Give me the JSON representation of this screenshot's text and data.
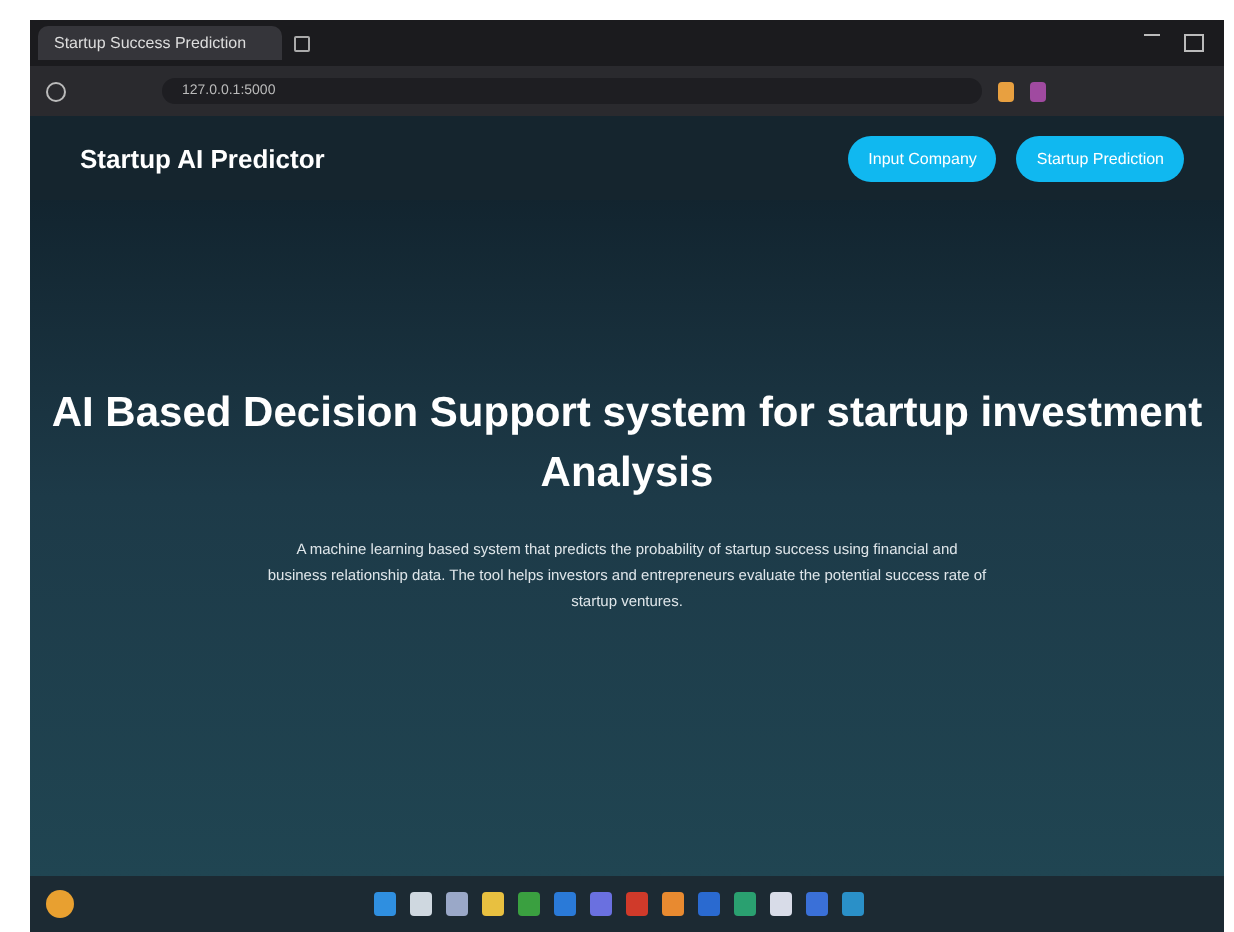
{
  "browser": {
    "tab_title": "Startup Success Prediction",
    "address": "127.0.0.1:5000"
  },
  "navbar": {
    "brand": "Startup AI Predictor",
    "buttons": [
      "Input Company",
      "Startup Prediction"
    ]
  },
  "hero": {
    "title": "AI Based Decision Support system for startup investment Analysis",
    "description": "A machine learning based system that predicts the probability of startup success using financial and business relationship data. The tool helps investors and entrepreneurs evaluate the potential success rate of startup ventures."
  },
  "taskbar": {
    "apps": [
      {
        "color": "#2f8fe0"
      },
      {
        "color": "#cfd8e0"
      },
      {
        "color": "#9aa8c8"
      },
      {
        "color": "#e8c040"
      },
      {
        "color": "#3aa040"
      },
      {
        "color": "#2a7ad8"
      },
      {
        "color": "#6a70e0"
      },
      {
        "color": "#d03a2a"
      },
      {
        "color": "#e88a30"
      },
      {
        "color": "#2a6ad0"
      },
      {
        "color": "#2aa070"
      },
      {
        "color": "#d8dce8"
      },
      {
        "color": "#3a70d8"
      },
      {
        "color": "#2a90c8"
      }
    ]
  }
}
